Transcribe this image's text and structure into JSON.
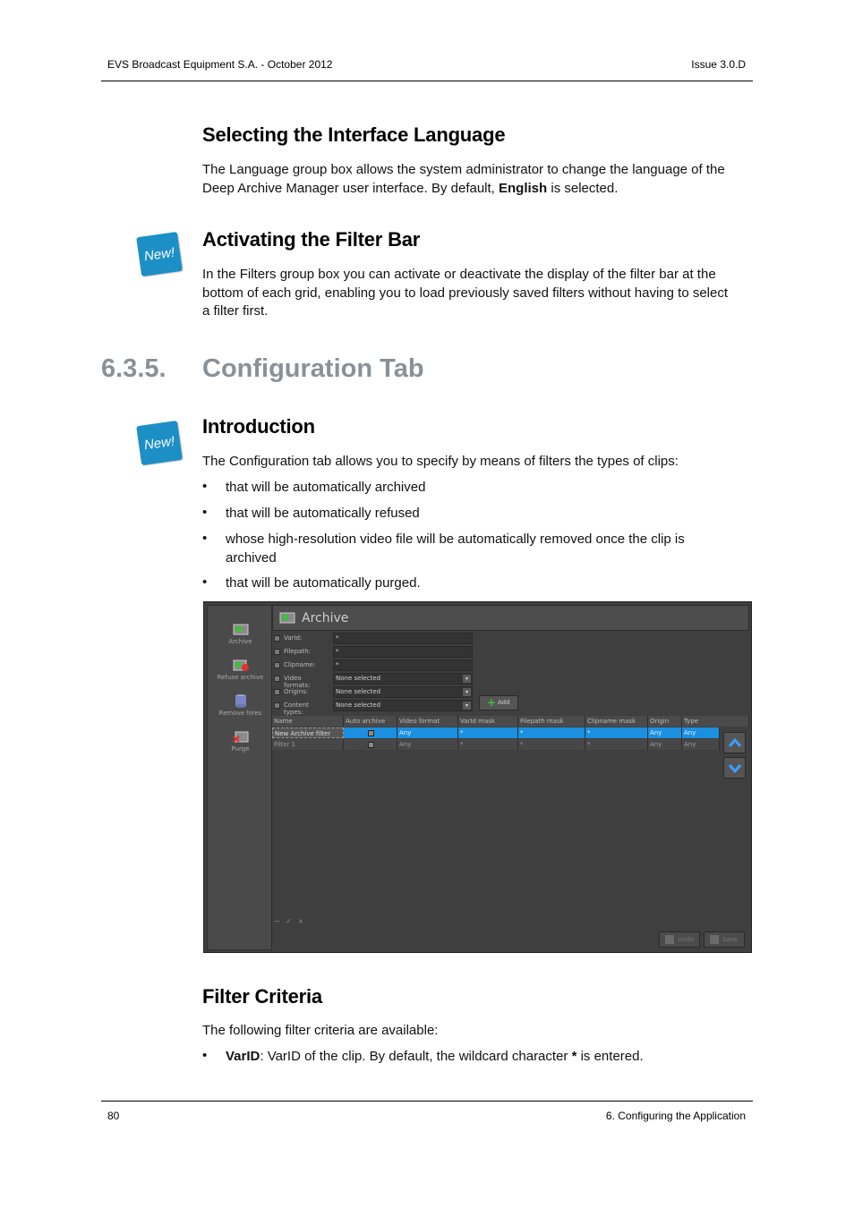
{
  "header": {
    "left": "EVS Broadcast Equipment S.A.  - October 2012",
    "right": "Issue 3.0.D"
  },
  "sections": {
    "lang_title": "Selecting the Interface Language",
    "lang_para_1": "The Language group box allows the system administrator to change the language of the",
    "lang_para_2a": "Deep Archive Manager user interface. By default, ",
    "lang_para_2b": "English",
    "lang_para_2c": " is selected.",
    "filterbar_title": "Activating the Filter Bar",
    "filterbar_para_1": "In the Filters group box you can activate or deactivate the display of the filter bar at the",
    "filterbar_para_2": "bottom of each grid, enabling you to load previously saved filters without having to select",
    "filterbar_para_3": "a filter first.",
    "chapter_num": "6.3.5.",
    "chapter_title": "Configuration Tab",
    "intro_title": "Introduction",
    "intro_para": "The Configuration tab allows you to specify by means of filters the types of clips:",
    "bullets": [
      "that will be automatically archived",
      "that will be automatically refused",
      "whose high-resolution video file will be automatically removed once the clip is archived",
      "that will be automatically purged."
    ],
    "criteria_title": "Filter Criteria",
    "criteria_para": "The following filter criteria are available:",
    "criteria_bullet_term": "VarID",
    "criteria_bullet_a": ": VarID of the clip. By default, the wildcard character ",
    "criteria_bullet_star": "*",
    "criteria_bullet_b": " is entered."
  },
  "badges": {
    "new_label": "New!"
  },
  "bullet_symbol": "•",
  "screenshot": {
    "sidebar": [
      "Archive",
      "Refuse archive",
      "Remove hires",
      "Purge"
    ],
    "title": "Archive",
    "form": [
      {
        "label": "VarId:",
        "value": "*"
      },
      {
        "label": "Filepath:",
        "value": "*"
      },
      {
        "label": "Clipname:",
        "value": "*"
      },
      {
        "label": "Video formats:",
        "value": "None selected"
      },
      {
        "label": "Origins:",
        "value": "None selected"
      },
      {
        "label": "Content types:",
        "value": "None selected"
      }
    ],
    "add_label": "Add",
    "columns": [
      "Name",
      "Auto archive",
      "Video format",
      "VarId mask",
      "Filepath mask",
      "Clipname mask",
      "Origin",
      "Type"
    ],
    "rows": [
      [
        "New Archive filter",
        "",
        "Any",
        "*",
        "*",
        "*",
        "Any",
        "Any"
      ],
      [
        "Filter 1",
        "",
        "Any",
        "*",
        "*",
        "*",
        "Any",
        "Any"
      ]
    ],
    "undo_label": "Undo",
    "save_label": "Save"
  },
  "footer": {
    "left": "80",
    "right": "6. Configuring the Application"
  }
}
